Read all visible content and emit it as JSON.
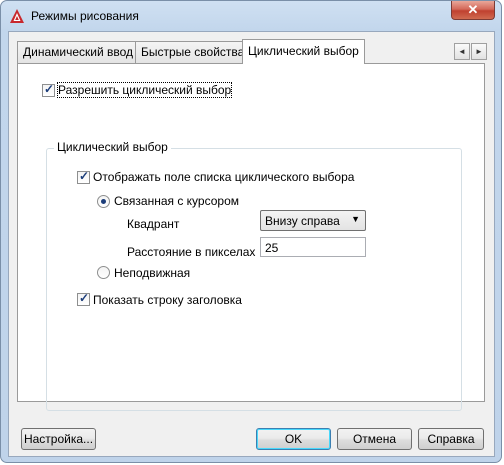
{
  "window": {
    "title": "Режимы рисования",
    "close_glyph": "✕",
    "icon": "autocad-logo-icon",
    "accent_color": "#c0412f"
  },
  "tabs": [
    {
      "label": "Динамический ввод",
      "active": false
    },
    {
      "label": "Быстрые свойства",
      "active": false
    },
    {
      "label": "Циклический выбор",
      "active": true
    }
  ],
  "tab_scroll": {
    "left": "◄",
    "right": "►"
  },
  "panel": {
    "enable_cycling": {
      "label": "Разрешить циклический выбор",
      "checked": true
    },
    "group_title": "Циклический выбор",
    "show_list": {
      "label": "Отображать поле списка циклического выбора",
      "checked": true
    },
    "cursor_dependent": {
      "label": "Связанная с курсором",
      "selected": true
    },
    "quadrant": {
      "label": "Квадрант",
      "value": "Внизу справа"
    },
    "distance": {
      "label": "Расстояние в пикселах",
      "value": "25"
    },
    "static": {
      "label": "Неподвижная",
      "selected": false
    },
    "show_title": {
      "label": "Показать строку заголовка",
      "checked": true
    }
  },
  "buttons": {
    "settings": "Настройка...",
    "ok": "OK",
    "cancel": "Отмена",
    "help": "Справка"
  }
}
